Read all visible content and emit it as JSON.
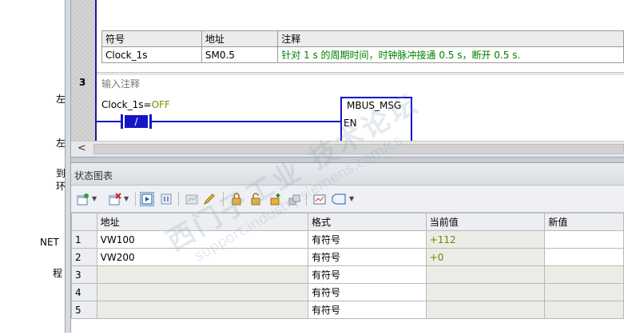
{
  "left_tree": {
    "items": [
      "左",
      "左",
      "到",
      "环",
      "NET",
      "程"
    ]
  },
  "editor": {
    "symbol_table": {
      "headers": [
        "符号",
        "地址",
        "注释"
      ],
      "row": {
        "symbol": "Clock_1s",
        "address": "SM0.5",
        "comment": "针对 1 s 的周期时间，时钟脉冲接通 0.5 s，断开 0.5 s."
      }
    },
    "network": {
      "number": "3",
      "comment_placeholder": "输入注释",
      "contact_symbol": "Clock_1s",
      "contact_state_eq": "=",
      "contact_state": "OFF",
      "contact_glyph": "/",
      "box_title": "MBUS_MSG",
      "box_pin": "EN"
    },
    "scroll_left": "<"
  },
  "status_chart": {
    "title": "状态图表",
    "columns": [
      "",
      "地址",
      "格式",
      "当前值",
      "新值"
    ],
    "rows": [
      {
        "num": "1",
        "address": "VW100",
        "format": "有符号",
        "current": "+112",
        "new": ""
      },
      {
        "num": "2",
        "address": "VW200",
        "format": "有符号",
        "current": "+0",
        "new": ""
      },
      {
        "num": "3",
        "address": "",
        "format": "有符号",
        "current": "",
        "new": ""
      },
      {
        "num": "4",
        "address": "",
        "format": "有符号",
        "current": "",
        "new": ""
      },
      {
        "num": "5",
        "address": "",
        "format": "有符号",
        "current": "",
        "new": ""
      }
    ],
    "toolbar_icons": [
      "insert-row-icon",
      "delete-row-icon",
      "single-read-icon",
      "pause-icon",
      "chart-trend-icon",
      "pen-write-icon",
      "lock-icon",
      "unlock-icon",
      "force-icon",
      "read-all-forced-icon",
      "trend-view-icon",
      "tag-icon"
    ]
  },
  "watermark": {
    "line1": "西门子工业 技术论坛",
    "line2": "support.industry.siemens.com/cs"
  },
  "colors": {
    "ladder_blue": "#1515c8",
    "comment_green": "#008000",
    "value_green": "#6a8a00"
  }
}
